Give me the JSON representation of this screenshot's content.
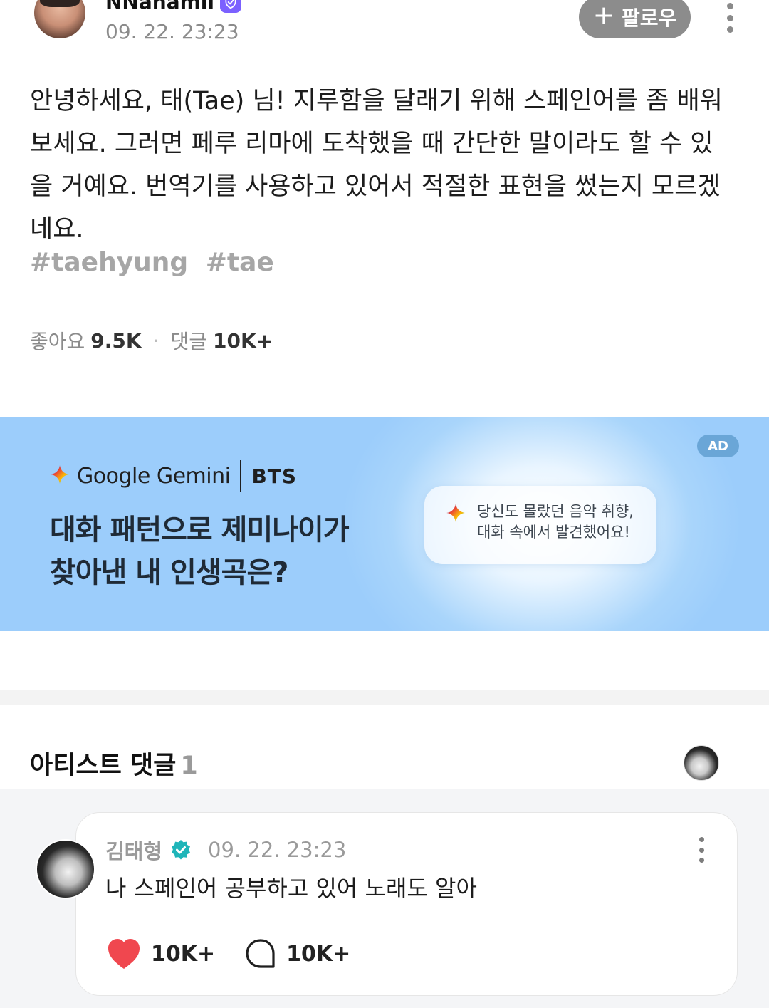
{
  "post": {
    "author": "NNanamii",
    "time": "09. 22. 23:23",
    "follow_label": "팔로우",
    "body": "안녕하세요, 태(Tae) 님! 지루함을 달래기 위해 스페인어를 좀 배워보세요. 그러면 페루 리마에 도착했을 때 간단한 말이라도 할 수 있을 거예요. 번역기를 사용하고 있어서 적절한 표현을 썼는지 모르겠네요.",
    "tags": [
      "#taehyung",
      "#tae"
    ],
    "stats": {
      "likes_label": "좋아요",
      "likes_value": "9.5K",
      "comments_label": "댓글",
      "comments_value": "10K+"
    }
  },
  "ad": {
    "badge": "AD",
    "brand": "Google Gemini",
    "partner": "BTS",
    "headline_line1": "대화 패턴으로 제미나이가",
    "headline_line2": "찾아낸 내 인생곡은?",
    "card_line1": "당신도 몰랐던 음악 취향,",
    "card_line2": "대화 속에서 발견했어요!"
  },
  "artist_comments": {
    "title": "아티스트 댓글",
    "count": "1",
    "comment": {
      "author": "김태형",
      "time": "09. 22. 23:23",
      "text": "나 스페인어 공부하고 있어 노래도 알아",
      "likes": "10K+",
      "replies": "10K+"
    }
  },
  "colors": {
    "follow_button": "#8c8c8c",
    "verified_badge": "#7b61ff",
    "artist_badge": "#1fb5b9",
    "heart": "#f0474f",
    "ad_background": "#9ccdfb"
  },
  "icons": {
    "verified": "shield-check-icon",
    "more": "vertical-dots-icon",
    "plus": "plus-icon",
    "sparkle": "gemini-sparkle-icon",
    "artist_badge": "verified-seal-icon",
    "heart": "heart-icon",
    "reply": "speech-bubble-icon"
  }
}
